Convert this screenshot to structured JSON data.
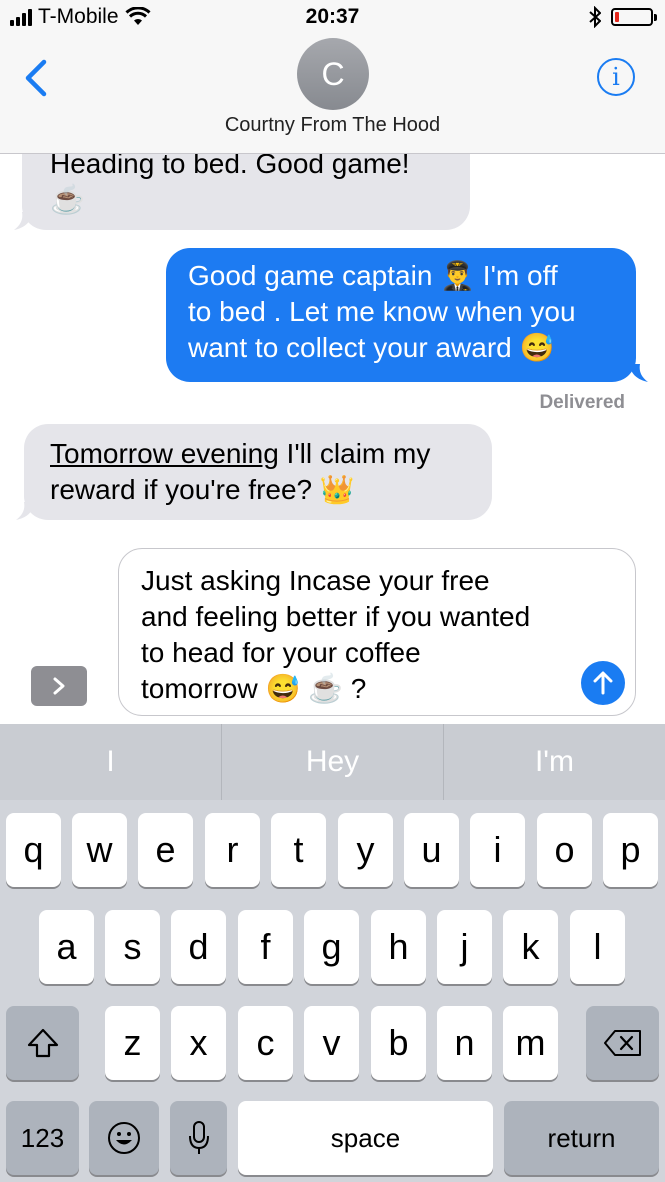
{
  "status_bar": {
    "carrier": "T-Mobile",
    "time": "20:37",
    "battery_level": 0.12,
    "icons": [
      "signal-icon",
      "wifi-icon",
      "bluetooth-icon",
      "battery-icon"
    ]
  },
  "header": {
    "avatar_initial": "C",
    "contact_name": "Courtny From The Hood",
    "icons": [
      "back-chevron-icon",
      "info-icon"
    ]
  },
  "messages": [
    {
      "direction": "incoming",
      "text": "Heading to bed. Good game!",
      "emoji": "☕"
    },
    {
      "direction": "outgoing",
      "line1": "Good game captain 👨‍✈️ I'm off",
      "line2": "to bed . Let me know when you",
      "line3": "want to collect your award 😅"
    },
    {
      "direction": "incoming",
      "underlined": "Tomorrow evening",
      "line1_rest": " I'll claim my",
      "line2": "reward if you're free? 👑"
    }
  ],
  "delivered_label": "Delivered",
  "compose": {
    "line1": "Just asking Incase your free",
    "line2": "and feeling better if you wanted",
    "line3": "to head for  your coffee",
    "line4": "tomorrow 😅  ☕ ?"
  },
  "predictions": [
    "I",
    "Hey",
    "I'm"
  ],
  "keyboard": {
    "row1": [
      "q",
      "w",
      "e",
      "r",
      "t",
      "y",
      "u",
      "i",
      "o",
      "p"
    ],
    "row2": [
      "a",
      "s",
      "d",
      "f",
      "g",
      "h",
      "j",
      "k",
      "l"
    ],
    "row3": [
      "z",
      "x",
      "c",
      "v",
      "b",
      "n",
      "m"
    ],
    "numbers_label": "123",
    "space_label": "space",
    "return_label": "return",
    "icons": [
      "shift-icon",
      "backspace-icon",
      "emoji-icon",
      "microphone-icon"
    ]
  }
}
